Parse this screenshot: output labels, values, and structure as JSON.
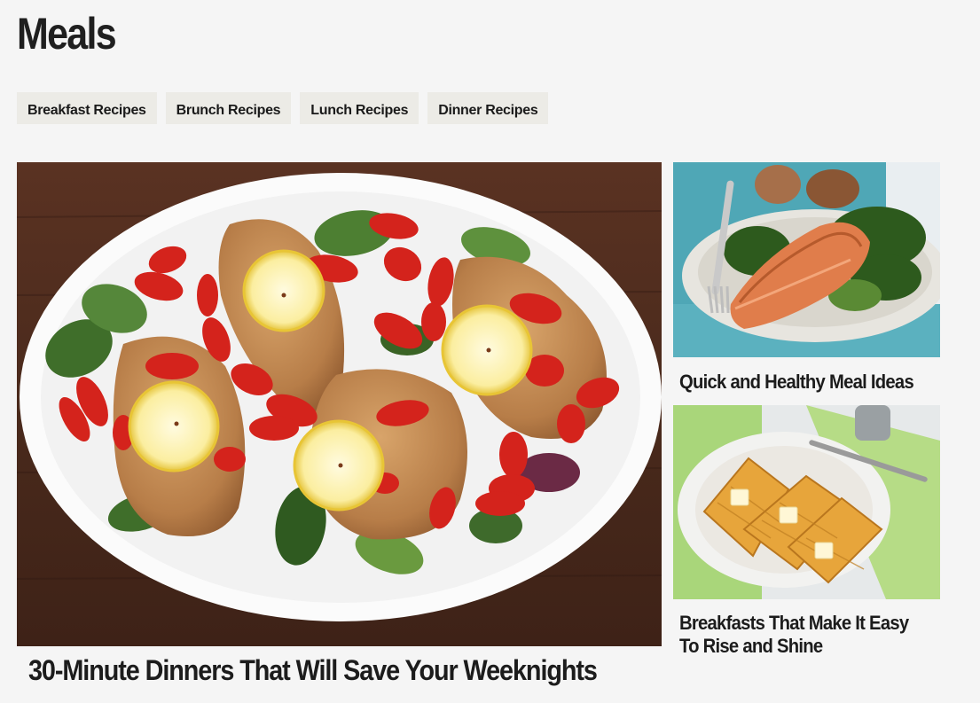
{
  "page": {
    "title": "Meals"
  },
  "categories": [
    {
      "label": "Breakfast Recipes"
    },
    {
      "label": "Brunch Recipes"
    },
    {
      "label": "Lunch Recipes"
    },
    {
      "label": "Dinner Recipes"
    }
  ],
  "feature": {
    "title": "30-Minute Dinners That Will Save Your Weeknights",
    "image": "crusted-chicken-cutlets-salad-lemon-tomatoes"
  },
  "side_cards": [
    {
      "title": "Quick and Healthy Meal Ideas",
      "image": "salmon-kale-salad-plate"
    },
    {
      "title": "Breakfasts That Make It Easy To Rise and Shine",
      "image": "waffles-butter-syrup-plate"
    }
  ],
  "colors": {
    "background": "#f5f5f5",
    "chip_background": "#ecebe6",
    "text": "#1f1f1f"
  }
}
